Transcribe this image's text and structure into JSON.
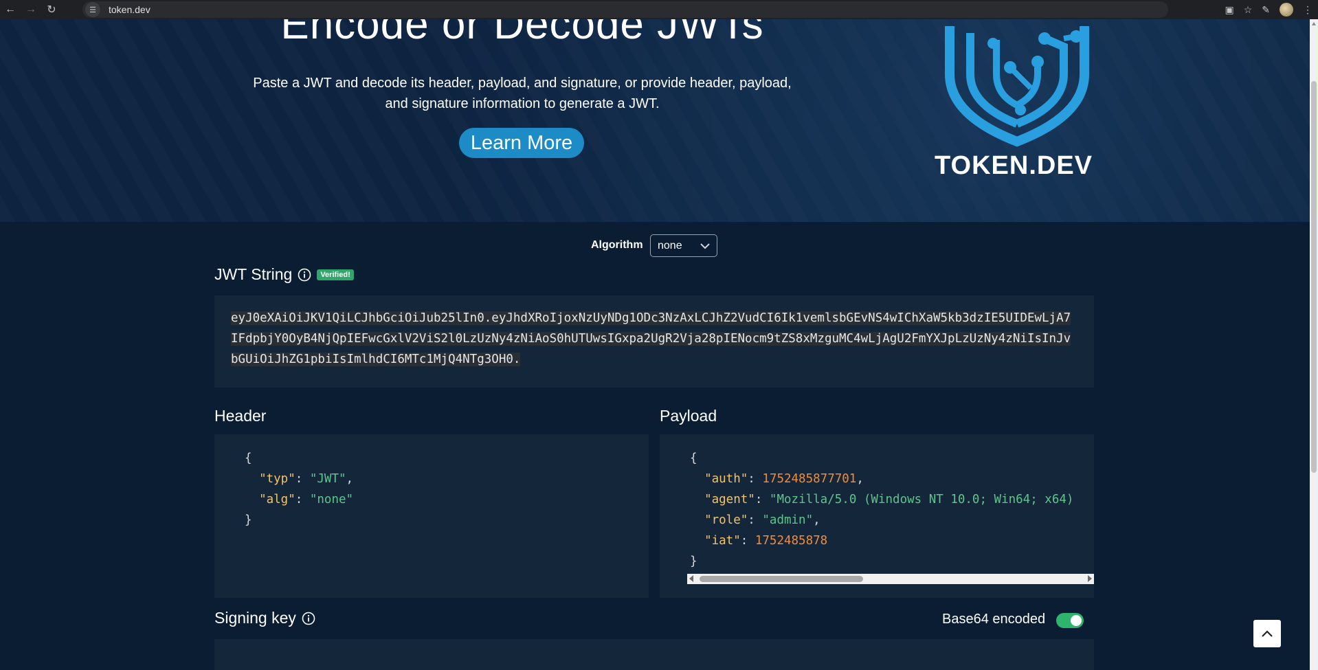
{
  "browser": {
    "url": "token.dev",
    "back_icon": "arrow-left-icon",
    "forward_icon": "arrow-right-icon",
    "reload_icon": "reload-icon"
  },
  "hero": {
    "title": "Encode or Decode JWTs",
    "description_line1": "Paste a JWT and decode its header, payload, and signature, or provide header, payload,",
    "description_line2": "and signature information to generate a JWT.",
    "learn_more": "Learn More",
    "logo_text": "TOKEN.DEV"
  },
  "algorithm": {
    "label": "Algorithm",
    "selected": "none"
  },
  "jwt": {
    "title": "JWT String",
    "badge": "Verified!",
    "value": "eyJ0eXAiOiJKV1QiLCJhbGciOiJub25lIn0.eyJhdXRoIjoxNzUyNDg1ODc3NzAxLCJhZ2VudCI6Ik1vemlsbGEvNS4wIChXaW5kb3dzIE5UIDEwLjA7IFdpbjY0OyB4NjQpIEFwcGxlV2ViS2l0LzUzNy4zNiAoS0hUTUwsIGxpa2UgR2Vja28pIENocm9tZS8xMzguMC4wLjAgU2FmYXJpLzUzNy4zNiIsInJvbGUiOiJhZG1pbiIsImlhdCI6MTc1MjQ4NTg3OH0."
  },
  "header": {
    "title": "Header",
    "typ_key": "\"typ\"",
    "typ_val": "\"JWT\"",
    "alg_key": "\"alg\"",
    "alg_val": "\"none\""
  },
  "payload": {
    "title": "Payload",
    "auth_key": "\"auth\"",
    "auth_val": "1752485877701",
    "agent_key": "\"agent\"",
    "agent_val": "\"Mozilla/5.0 (Windows NT 10.0; Win64; x64)",
    "role_key": "\"role\"",
    "role_val": "\"admin\"",
    "iat_key": "\"iat\"",
    "iat_val": "1752485878"
  },
  "signing": {
    "title": "Signing key",
    "base64_label": "Base64 encoded",
    "base64_enabled": true
  },
  "colors": {
    "background": "#0b1d33",
    "panel": "#14263a",
    "accent": "#1d8cc6",
    "verified": "#2fa66a",
    "json_key": "#f2c36b",
    "json_string": "#5fc58b",
    "json_number": "#f08c3a"
  }
}
